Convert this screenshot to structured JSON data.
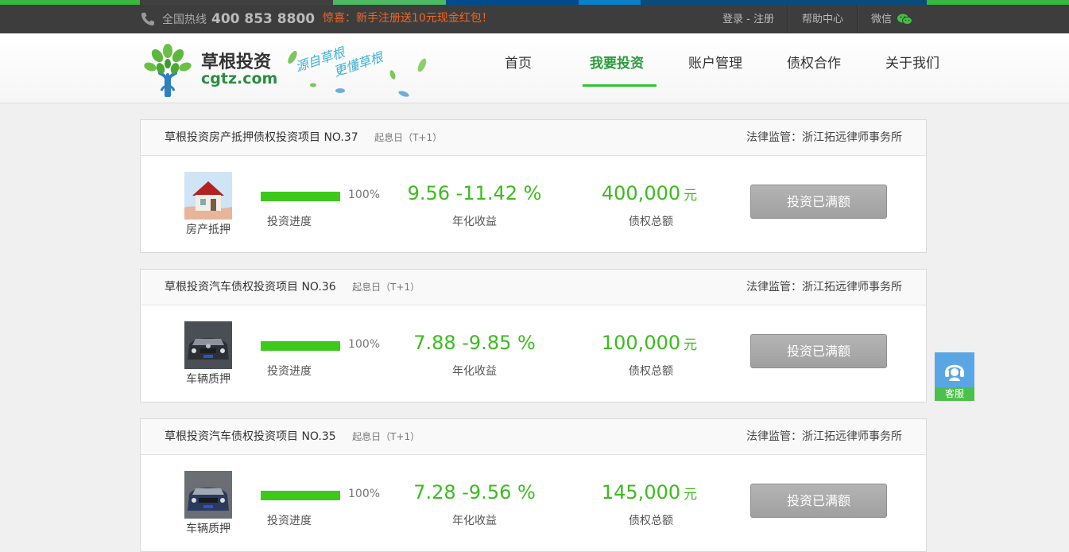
{
  "colors": {
    "accent_green": "#3cbb1e",
    "promo_orange": "#f26522",
    "service_blue": "#5aa6e4",
    "button_gray": "#a8a8a8",
    "strip": [
      "#3ab73e",
      "#414141",
      "#4dba63",
      "#004b8d",
      "#0a81c6",
      "#084c7c",
      "#3ab73e"
    ]
  },
  "topbar": {
    "phone_icon": "phone-icon",
    "hotline_label": "全国热线",
    "hotline_number": "400 853 8800",
    "promo": "惊喜：新手注册送10元现金红包！",
    "login": "登录 - 注册",
    "help": "帮助中心",
    "wechat": "微信",
    "wechat_icon": "wechat-icon"
  },
  "header": {
    "brand_cn": "草根投资",
    "brand_en": "cgtz.com",
    "slogan_line1": "源自草根",
    "slogan_line2": "更懂草根",
    "nav": [
      {
        "label": "首页",
        "active": false
      },
      {
        "label": "我要投资",
        "active": true
      },
      {
        "label": "账户管理",
        "active": false
      },
      {
        "label": "债权合作",
        "active": false
      },
      {
        "label": "关于我们",
        "active": false
      }
    ]
  },
  "projects": [
    {
      "title": "草根投资房产抵押债权投资项目 NO.37",
      "date_label": "起息日（T+1）",
      "legal": "法律监管：浙江拓远律师事务所",
      "type_label": "房产抵押",
      "thumb": "house-icon",
      "progress": 100,
      "progress_text": "100%",
      "progress_label": "投资进度",
      "rate": "9.56 -11.42 %",
      "rate_label": "年化收益",
      "amount": "400,000",
      "unit": "元",
      "amount_label": "债权总额",
      "button": "投资已满额"
    },
    {
      "title": "草根投资汽车债权投资项目 NO.36",
      "date_label": "起息日（T+1）",
      "legal": "法律监管：浙江拓远律师事务所",
      "type_label": "车辆质押",
      "thumb": "car-icon",
      "progress": 100,
      "progress_text": "100%",
      "progress_label": "投资进度",
      "rate": "7.88 -9.85 %",
      "rate_label": "年化收益",
      "amount": "100,000",
      "unit": "元",
      "amount_label": "债权总额",
      "button": "投资已满额"
    },
    {
      "title": "草根投资汽车债权投资项目 NO.35",
      "date_label": "起息日（T+1）",
      "legal": "法律监管：浙江拓远律师事务所",
      "type_label": "车辆质押",
      "thumb": "car-icon",
      "progress": 100,
      "progress_text": "100%",
      "progress_label": "投资进度",
      "rate": "7.28 -9.56 %",
      "rate_label": "年化收益",
      "amount": "145,000",
      "unit": "元",
      "amount_label": "债权总额",
      "button": "投资已满额"
    }
  ],
  "service": {
    "label": "客服",
    "icon": "headset-icon"
  }
}
